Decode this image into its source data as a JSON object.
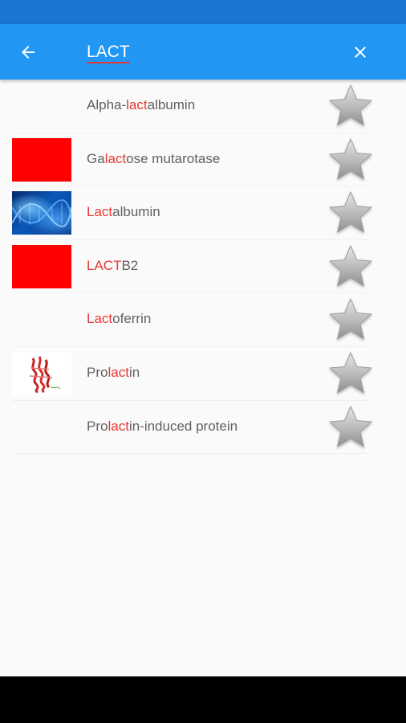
{
  "colors": {
    "status_bar": "#1976d2",
    "app_bar": "#2196f3",
    "highlight": "#e53935",
    "label_text": "#616161",
    "background": "#fafafa",
    "navigation_bar": "#000000"
  },
  "search": {
    "query": "LACT",
    "back_icon": "arrow-left-icon",
    "clear_icon": "close-icon"
  },
  "results": [
    {
      "thumb": "none",
      "label": {
        "pre": "Alpha-",
        "hl": "lact",
        "post": "albumin"
      },
      "favorite": false
    },
    {
      "thumb": "red-square",
      "label": {
        "pre": "Ga",
        "hl": "lact",
        "post": "ose mutarotase"
      },
      "favorite": false
    },
    {
      "thumb": "dna-image",
      "label": {
        "pre": "",
        "hl": "Lact",
        "post": "albumin"
      },
      "favorite": false
    },
    {
      "thumb": "red-square",
      "label": {
        "pre": "",
        "hl": "LACT",
        "post": "B2"
      },
      "favorite": false
    },
    {
      "thumb": "none",
      "label": {
        "pre": "",
        "hl": "Lact",
        "post": "oferrin"
      },
      "favorite": false
    },
    {
      "thumb": "protein-structure",
      "label": {
        "pre": "Pro",
        "hl": "lact",
        "post": "in"
      },
      "favorite": false
    },
    {
      "thumb": "none",
      "label": {
        "pre": "Pro",
        "hl": "lact",
        "post": "in-induced protein"
      },
      "favorite": false
    }
  ],
  "star_icon": "star-icon"
}
